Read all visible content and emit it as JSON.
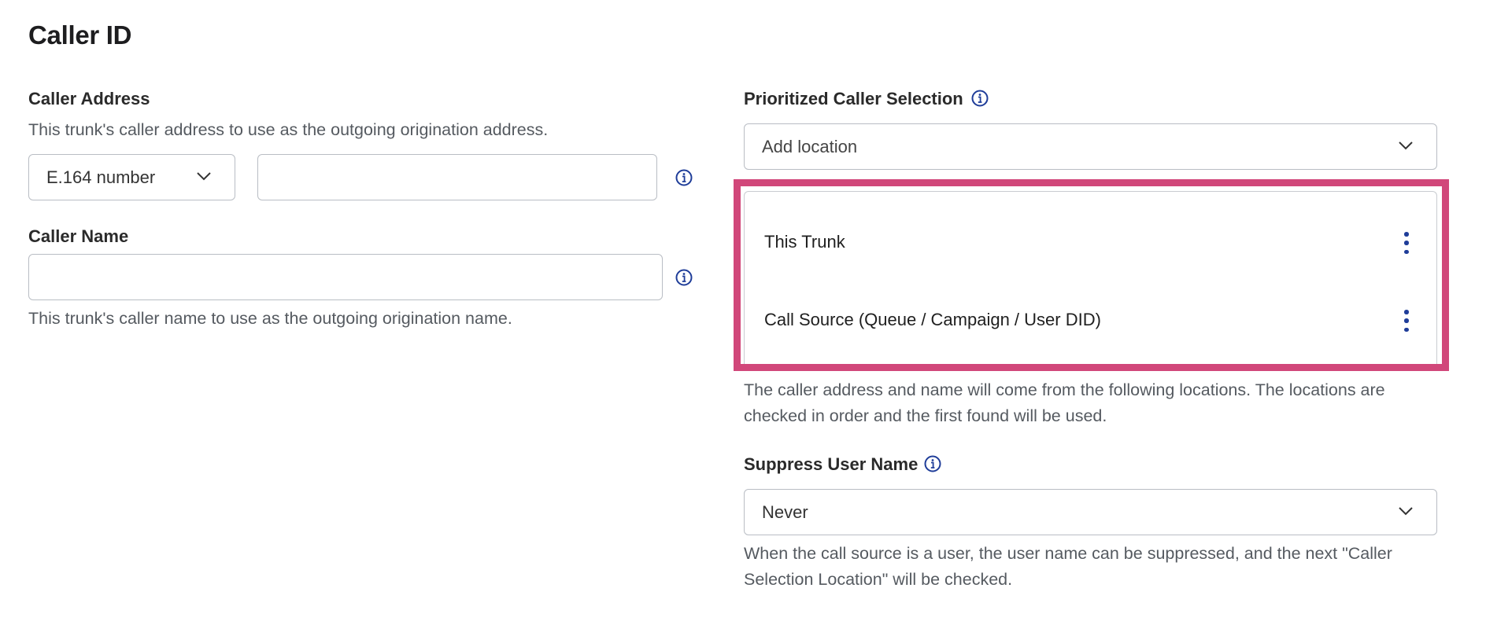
{
  "page": {
    "title": "Caller ID"
  },
  "caller_address": {
    "label": "Caller Address",
    "description": "This trunk's caller address to use as the outgoing origination address.",
    "type_select_value": "E.164 number",
    "address_value": "",
    "address_placeholder": ""
  },
  "caller_name": {
    "label": "Caller Name",
    "value": "",
    "placeholder": "",
    "description": "This trunk's caller name to use as the outgoing origination name."
  },
  "prioritized": {
    "label": "Prioritized Caller Selection",
    "add_location_placeholder": "Add location",
    "items": [
      {
        "label": "This Trunk"
      },
      {
        "label": "Call Source (Queue / Campaign / User DID)"
      }
    ],
    "description_line1": "The caller address and name will come from the following locations. The locations are",
    "description_line2": "checked in order and the first found will be used."
  },
  "suppress_user_name": {
    "label": "Suppress User Name",
    "value": "Never",
    "description_line1": "When the call source is a user, the user name can be suppressed, and the next \"Caller",
    "description_line2": "Selection Location\" will be checked."
  },
  "colors": {
    "highlight": "#d1477a",
    "info_icon": "#1f3d99",
    "kebab": "#1f3d99"
  },
  "icons": {
    "info": "info-icon",
    "chevron": "chevron-down-icon",
    "more": "more-vertical-icon"
  }
}
